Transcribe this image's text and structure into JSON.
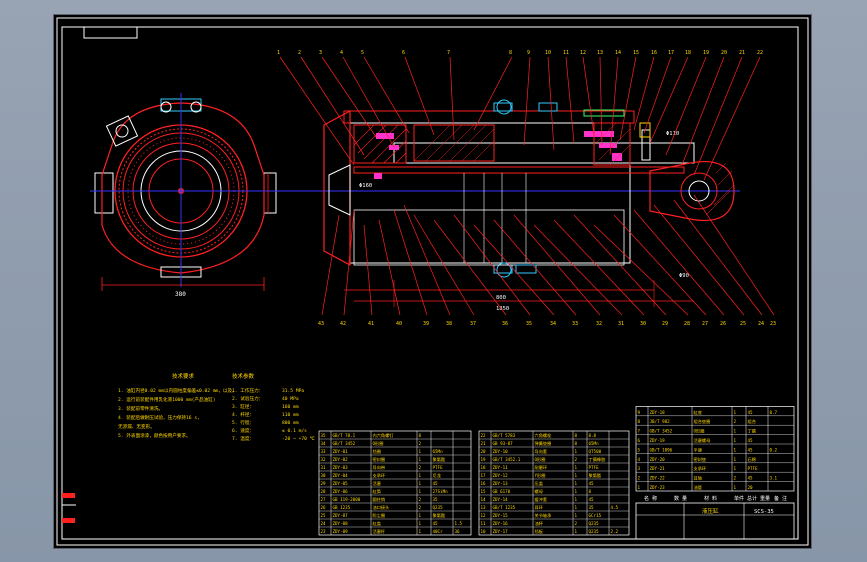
{
  "sheet": {
    "title_block": {
      "name_header": "名 称",
      "qty_header": "数 量",
      "material_header": "材 料",
      "weight_header": "单件 总计 重量",
      "remark_header": "备 注",
      "drawing_title": "液压缸",
      "drawing_no": "SCS-35"
    },
    "tech_requirements": {
      "title": "技术要求",
      "lines": [
        "1. 油缸内径0.02 mm以内圆柱度偏差≤0.02 mm，以及。",
        "2. 运行前装配件用乳化液1000 mm(产品油缸)",
        "3. 装配前零件清洗。",
        "4. 装配后做耐压试验，压力保持16 s，",
        "   无渗漏、无变形。",
        "5. 外表面涂漆，颜色按用户要求。"
      ]
    },
    "tech_params": {
      "title": "技术参数",
      "rows": [
        {
          "label": "1. 工作压力：",
          "value": "31.5 MPa"
        },
        {
          "label": "2. 试验压力：",
          "value": "40 MPa"
        },
        {
          "label": "3. 缸径：",
          "value": "160 mm"
        },
        {
          "label": "4. 杆径：",
          "value": "110 mm"
        },
        {
          "label": "5. 行程：",
          "value": "800 mm"
        },
        {
          "label": "6. 速度：",
          "value": "≤ 0.1 m/s"
        },
        {
          "label": "7. 温度：",
          "value": "-20 ~ +70 ℃"
        }
      ]
    },
    "bom_left_rows": [
      [
        "35",
        "GB/T 70.1",
        "内六角螺钉",
        "8",
        "",
        ""
      ],
      [
        "34",
        "GB/T 3452",
        "O形圈",
        "2",
        "",
        ""
      ],
      [
        "33",
        "ZDY-01",
        "挡圈",
        "1",
        "65Mn",
        ""
      ],
      [
        "32",
        "ZDY-02",
        "密封圈",
        "1",
        "聚氨酯",
        ""
      ],
      [
        "31",
        "ZDY-03",
        "导向带",
        "2",
        "PTFE",
        ""
      ],
      [
        "30",
        "ZDY-04",
        "支承环",
        "1",
        "尼龙",
        ""
      ],
      [
        "29",
        "ZDY-05",
        "活塞",
        "1",
        "45",
        ""
      ],
      [
        "28",
        "ZDY-06",
        "缸筒",
        "1",
        "27SiMn",
        ""
      ],
      [
        "27",
        "GB 119-2000",
        "圆柱销",
        "2",
        "35",
        ""
      ],
      [
        "26",
        "GB 1235",
        "油口接头",
        "2",
        "Q235",
        ""
      ],
      [
        "25",
        "ZDY-07",
        "防尘圈",
        "1",
        "聚氨酯",
        ""
      ],
      [
        "24",
        "ZDY-08",
        "缸盖",
        "1",
        "45",
        "1.5"
      ],
      [
        "23",
        "ZDY-09",
        "活塞杆",
        "1",
        "40Cr",
        "36"
      ]
    ],
    "bom_mid_rows": [
      [
        "22",
        "GB/T 5783",
        "六角螺栓",
        "8",
        "8.8",
        ""
      ],
      [
        "21",
        "GB 93-87",
        "弹簧垫圈",
        "8",
        "65Mn",
        ""
      ],
      [
        "20",
        "ZDY-10",
        "导向套",
        "1",
        "QT500",
        ""
      ],
      [
        "19",
        "GB/T 3452.1",
        "O形圈",
        "2",
        "丁腈橡胶",
        ""
      ],
      [
        "18",
        "ZDY-11",
        "耐磨环",
        "1",
        "PTFE",
        ""
      ],
      [
        "17",
        "ZDY-12",
        "Y形圈",
        "1",
        "聚氨酯",
        ""
      ],
      [
        "16",
        "ZDY-13",
        "压盖",
        "1",
        "45",
        ""
      ],
      [
        "15",
        "GB 6170",
        "螺母",
        "1",
        "8",
        ""
      ],
      [
        "14",
        "ZDY-14",
        "缓冲套",
        "1",
        "45",
        ""
      ],
      [
        "13",
        "GB/T 1235",
        "耳环",
        "1",
        "35",
        "4.5"
      ],
      [
        "12",
        "ZDY-15",
        "关节轴承",
        "1",
        "GCr15",
        ""
      ],
      [
        "11",
        "ZDY-16",
        "油杯",
        "2",
        "Q235",
        ""
      ],
      [
        "10",
        "ZDY-17",
        "挡板",
        "1",
        "Q235",
        "2.2"
      ]
    ],
    "bom_right_rows": [
      [
        "9",
        "ZDY-18",
        "缸底",
        "1",
        "45",
        "8.7"
      ],
      [
        "8",
        "JB/T 982",
        "组合垫圈",
        "2",
        "组合",
        ""
      ],
      [
        "7",
        "GB/T 3452",
        "O形圈",
        "1",
        "丁腈",
        ""
      ],
      [
        "6",
        "ZDY-19",
        "活塞螺母",
        "1",
        "45",
        ""
      ],
      [
        "5",
        "GB/T 1096",
        "平键",
        "1",
        "45",
        "0.2"
      ],
      [
        "4",
        "ZDY-20",
        "密封垫",
        "1",
        "石棉",
        ""
      ],
      [
        "3",
        "ZDY-21",
        "支承环",
        "1",
        "PTFE",
        ""
      ],
      [
        "2",
        "ZDY-22",
        "耳轴",
        "2",
        "45",
        "3.1"
      ],
      [
        "1",
        "ZDY-23",
        "油管",
        "1",
        "20",
        ""
      ]
    ],
    "leader_numbers_top": [
      "1",
      "2",
      "3",
      "4",
      "5",
      "6",
      "7",
      "8",
      "9",
      "10",
      "11",
      "12",
      "13",
      "14",
      "15",
      "16",
      "17",
      "18",
      "19",
      "20",
      "21",
      "22"
    ],
    "leader_numbers_bottom": [
      "43",
      "42",
      "41",
      "40",
      "39",
      "38",
      "37",
      "36",
      "35",
      "34",
      "33",
      "32",
      "31",
      "30",
      "29",
      "28",
      "27",
      "26",
      "25",
      "24",
      "23"
    ],
    "dimensions": {
      "overall": "1850",
      "stroke": "800",
      "bore": "Φ160",
      "rod": "Φ110",
      "end_view_width": "380",
      "mount": "Φ90"
    }
  }
}
